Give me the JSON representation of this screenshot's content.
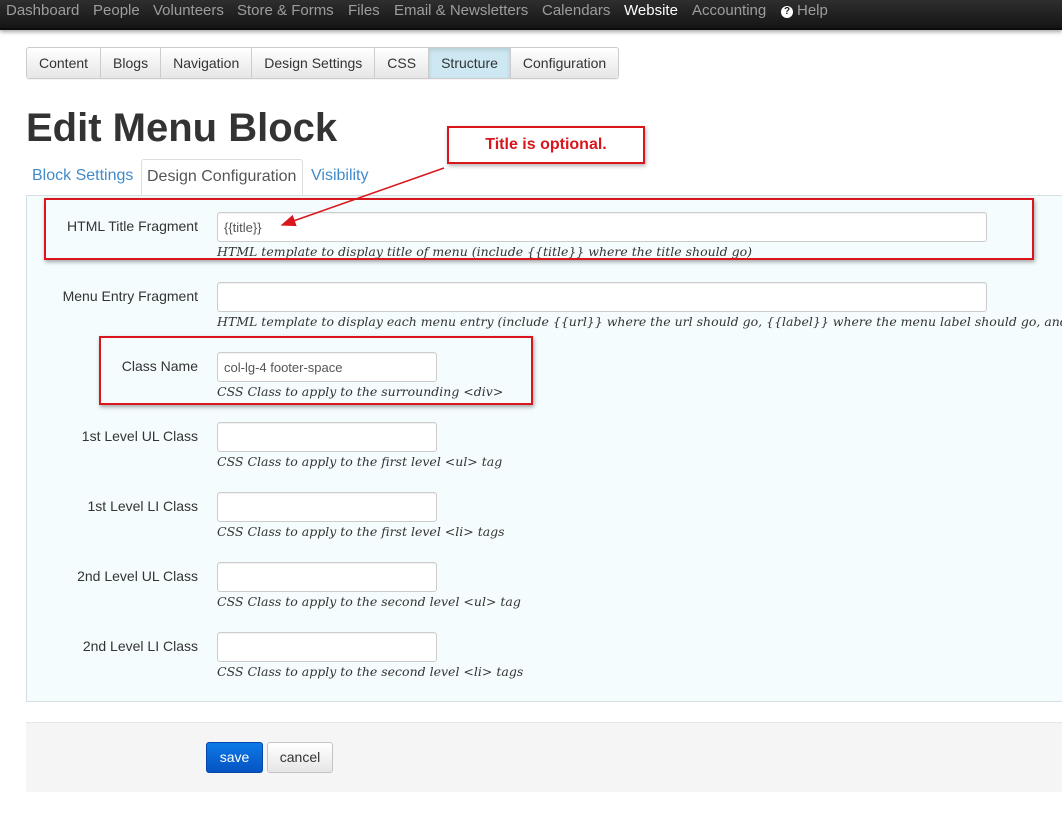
{
  "topnav": {
    "items": [
      {
        "label": "Dashboard"
      },
      {
        "label": "People"
      },
      {
        "label": "Volunteers"
      },
      {
        "label": "Store & Forms"
      },
      {
        "label": "Files"
      },
      {
        "label": "Email & Newsletters"
      },
      {
        "label": "Calendars"
      },
      {
        "label": "Website",
        "active": true
      },
      {
        "label": "Accounting"
      },
      {
        "label": "Help",
        "icon": "question-circle-icon"
      }
    ]
  },
  "subtabs": [
    "Content",
    "Blogs",
    "Navigation",
    "Design Settings",
    "CSS",
    "Structure",
    "Configuration"
  ],
  "subtabs_active": "Structure",
  "page": {
    "title": "Edit Menu Block"
  },
  "block_tabs": [
    "Block Settings",
    "Design Configuration",
    "Visibility"
  ],
  "block_tabs_active": "Design Configuration",
  "form": {
    "html_title": {
      "label": "HTML Title Fragment",
      "value": "{{title}}",
      "help": "HTML template to display title of menu (include {{title}} where the title should go)"
    },
    "menu_entry": {
      "label": "Menu Entry Fragment",
      "value": "",
      "help": "HTML template to display each menu entry (include {{url}} where the url should go, {{label}} where the menu label should go, and {{ta"
    },
    "class_name": {
      "label": "Class Name",
      "value": "col-lg-4 footer-space",
      "help": "CSS Class to apply to the surrounding <div>"
    },
    "ul1": {
      "label": "1st Level UL Class",
      "value": "",
      "help": "CSS Class to apply to the first level <ul> tag"
    },
    "li1": {
      "label": "1st Level LI Class",
      "value": "",
      "help": "CSS Class to apply to the first level <li> tags"
    },
    "ul2": {
      "label": "2nd Level UL Class",
      "value": "",
      "help": "CSS Class to apply to the second level <ul> tag"
    },
    "li2": {
      "label": "2nd Level LI Class",
      "value": "",
      "help": "CSS Class to apply to the second level <li> tags"
    }
  },
  "actions": {
    "save": "save",
    "cancel": "cancel"
  },
  "annotation": {
    "callout": "Title is optional."
  },
  "colors": {
    "nav_bg": "#1c1c1c",
    "link": "#428bca",
    "panel_bg": "#f5fcfe",
    "annotation_red": "#d9161c",
    "save_blue": "#0a64d6",
    "active_subtab": "#cde8f2"
  }
}
